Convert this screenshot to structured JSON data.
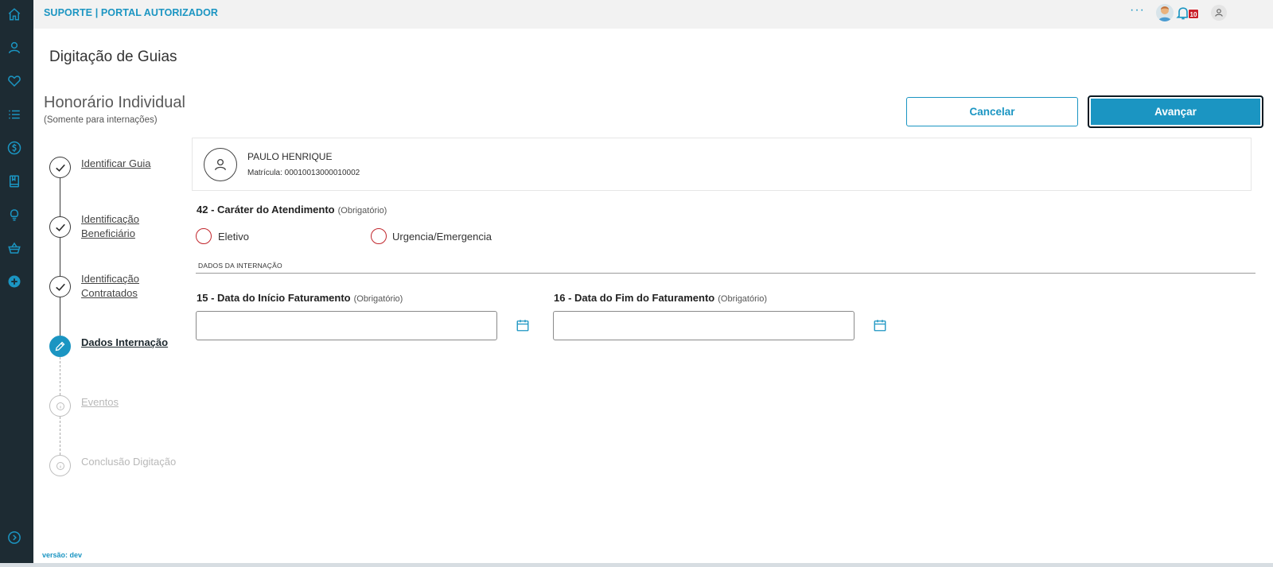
{
  "sidebar": {
    "items": [
      {
        "icon": "home-icon"
      },
      {
        "icon": "user-icon"
      },
      {
        "icon": "heart-icon"
      },
      {
        "icon": "list-icon"
      },
      {
        "icon": "dollar-icon"
      },
      {
        "icon": "book-icon"
      },
      {
        "icon": "lightbulb-icon"
      },
      {
        "icon": "basket-icon"
      },
      {
        "icon": "plus-circle-icon"
      }
    ],
    "expand_icon": "chevron-right-icon"
  },
  "header": {
    "app_title": "SUPORTE | PORTAL AUTORIZADOR",
    "more_label": "···",
    "notifications_count": "10"
  },
  "page": {
    "title": "Digitação de Guias",
    "section_title": "Honorário Individual",
    "section_subtitle": "(Somente para internações)",
    "cancel_label": "Cancelar",
    "advance_label": "Avançar"
  },
  "stepper": {
    "steps": [
      {
        "label": "Identificar Guia",
        "status": "done"
      },
      {
        "label": "Identificação",
        "label2": "Beneficiário",
        "status": "done"
      },
      {
        "label": "Identificação",
        "label2": "Contratados",
        "status": "done"
      },
      {
        "label": "Dados Internação",
        "status": "active"
      },
      {
        "label": "Eventos",
        "status": "pending"
      },
      {
        "label": "Conclusão Digitação",
        "status": "pending"
      }
    ]
  },
  "beneficiary": {
    "name": "PAULO HENRIQUE",
    "matricula": "Matrícula: 00010013000010002"
  },
  "form": {
    "carater_label": "42 - Caráter do Atendimento",
    "required_label": "(Obrigatório)",
    "options": [
      "Eletivo",
      "Urgencia/Emergencia"
    ],
    "section_label": "DADOS DA INTERNAÇÃO",
    "start_date_label": "15 - Data do Início Faturamento",
    "end_date_label": "16 - Data do Fim do Faturamento",
    "start_date_value": "",
    "end_date_value": ""
  },
  "footer": {
    "version": "versão: dev"
  },
  "colors": {
    "accent": "#1b95c2",
    "sidebar": "#1d2b33",
    "radio_border": "#c1272d",
    "badge": "#c9202a"
  }
}
